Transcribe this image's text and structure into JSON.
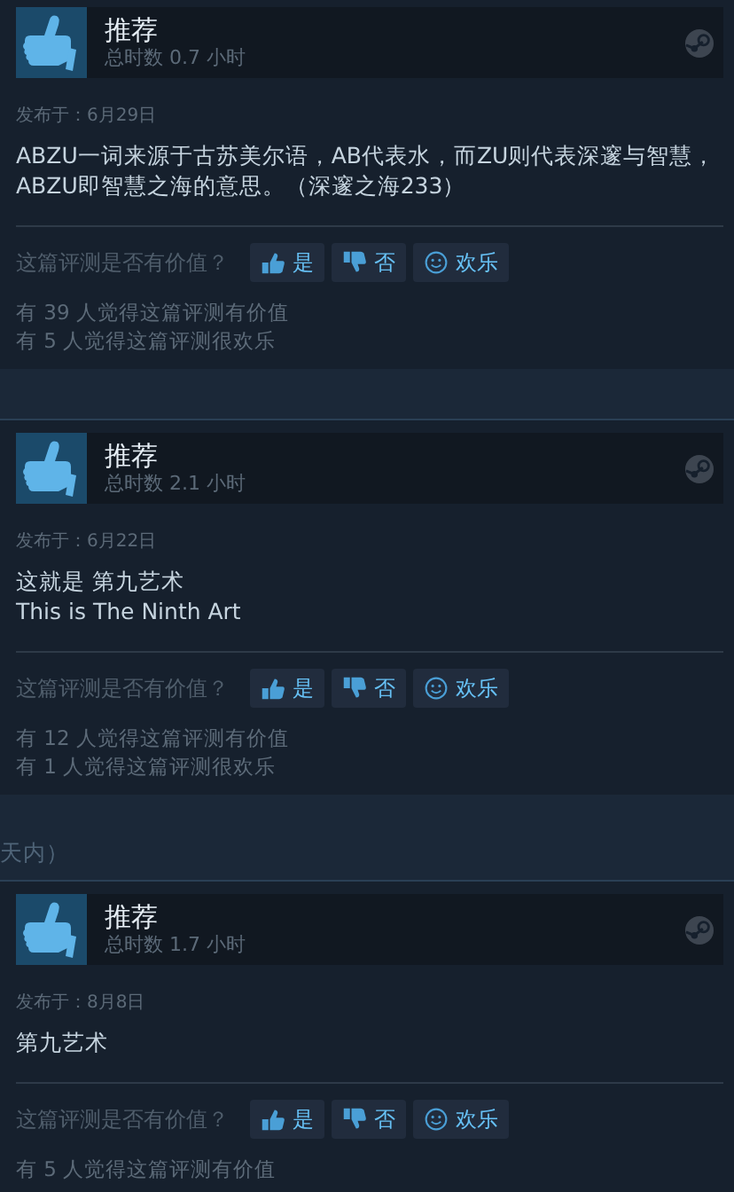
{
  "feed": [
    {
      "kind": "review",
      "verdict": "推荐",
      "hours": "总时数 0.7 小时",
      "date": "发布于：6月29日",
      "body": [
        "ABZU一词来源于古苏美尔语，AB代表水，而ZU则代表深邃与智慧，ABZU即智慧之海的意思。（深邃之海233）"
      ],
      "prompt": "这篇评测是否有价值？",
      "buttons": [
        {
          "kind": "yes",
          "label": "是"
        },
        {
          "kind": "no",
          "label": "否"
        },
        {
          "kind": "funny",
          "label": "欢乐"
        }
      ],
      "counts": [
        "有 39 人觉得这篇评测有价值",
        "有 5 人觉得这篇评测很欢乐"
      ]
    },
    {
      "kind": "review",
      "verdict": "推荐",
      "hours": "总时数 2.1 小时",
      "date": "发布于：6月22日",
      "body": [
        "这就是 第九艺术",
        "This is The Ninth Art"
      ],
      "prompt": "这篇评测是否有价值？",
      "buttons": [
        {
          "kind": "yes",
          "label": "是"
        },
        {
          "kind": "no",
          "label": "否"
        },
        {
          "kind": "funny",
          "label": "欢乐"
        }
      ],
      "counts": [
        "有 12 人觉得这篇评测有价值",
        "有 1 人觉得这篇评测很欢乐"
      ]
    },
    {
      "kind": "note",
      "text": "天内）"
    },
    {
      "kind": "review",
      "verdict": "推荐",
      "hours": "总时数 1.7 小时",
      "date": "发布于：8月8日",
      "body": [
        "第九艺术"
      ],
      "prompt": "这篇评测是否有价值？",
      "buttons": [
        {
          "kind": "yes",
          "label": "是"
        },
        {
          "kind": "no",
          "label": "否"
        },
        {
          "kind": "funny",
          "label": "欢乐"
        }
      ],
      "counts": [
        "有 5 人觉得这篇评测有价值"
      ]
    }
  ]
}
